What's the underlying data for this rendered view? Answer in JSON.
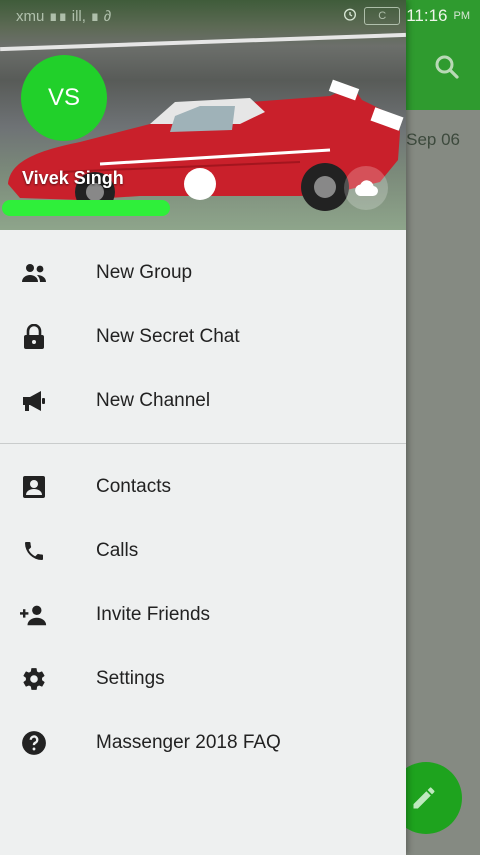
{
  "status_bar": {
    "left_text": "xmu ∎∎ ill, ∎ ∂",
    "time": "11:16",
    "ampm": "PM",
    "battery_label": "C"
  },
  "background": {
    "date_label": "Sep 06"
  },
  "drawer": {
    "avatar_initials": "VS",
    "user_name": "Vivek Singh",
    "accent_color": "#21d02a",
    "menu_section_1": [
      {
        "label": "New Group",
        "icon": "group-icon"
      },
      {
        "label": "New Secret Chat",
        "icon": "lock-icon"
      },
      {
        "label": "New Channel",
        "icon": "megaphone-icon"
      }
    ],
    "menu_section_2": [
      {
        "label": "Contacts",
        "icon": "contact-card-icon"
      },
      {
        "label": "Calls",
        "icon": "phone-icon"
      },
      {
        "label": "Invite Friends",
        "icon": "add-person-icon"
      },
      {
        "label": "Settings",
        "icon": "gear-icon"
      },
      {
        "label": "Massenger 2018 FAQ",
        "icon": "help-circle-icon"
      }
    ]
  }
}
